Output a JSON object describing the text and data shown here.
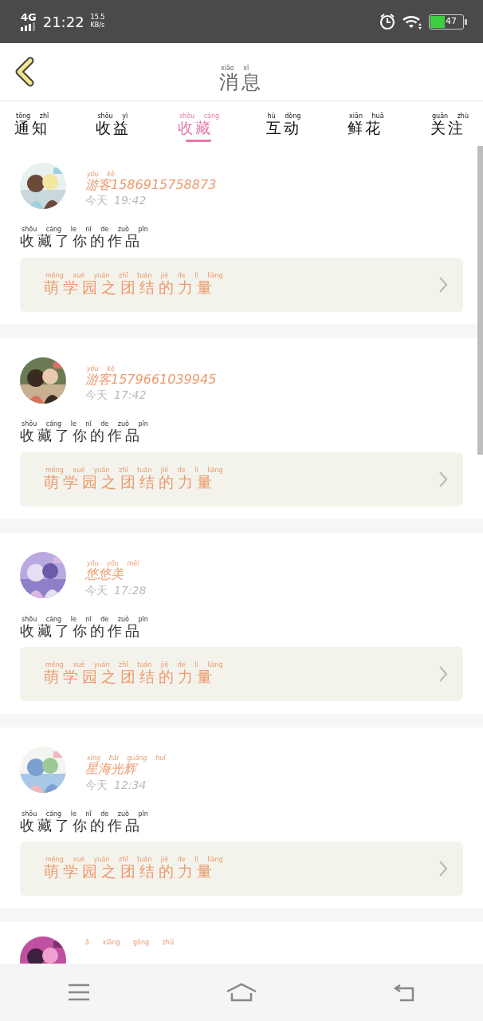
{
  "status_bar": {
    "network": "4G",
    "time": "21:22",
    "speed": "15.5",
    "speed_unit": "KB/s",
    "battery": "47"
  },
  "header": {
    "title": {
      "text": "消息",
      "pinyin": "xiāo xī"
    }
  },
  "tabs": [
    {
      "text": "通知",
      "pinyin": "tōng zhī",
      "selected": false
    },
    {
      "text": "收益",
      "pinyin": "shōu yì",
      "selected": false
    },
    {
      "text": "收藏",
      "pinyin": "shōu cáng",
      "selected": true
    },
    {
      "text": "互动",
      "pinyin": "hù dòng",
      "selected": false
    },
    {
      "text": "鲜花",
      "pinyin": "xiān huā",
      "selected": false
    },
    {
      "text": "关注",
      "pinyin": "guān zhù",
      "selected": false
    }
  ],
  "messages": [
    {
      "name": {
        "text": "游客1586915758873",
        "pinyin": "yóu kè"
      },
      "day": "今天",
      "time": "19:42",
      "action": {
        "text": "收藏了你的作品",
        "pinyin": "shōu cáng le nǐ de zuò pǐn"
      },
      "work": {
        "text": "萌学园之团结的力量",
        "pinyin": "méng xué yuán zhī tuán jié de lì liàng"
      }
    },
    {
      "name": {
        "text": "游客1579661039945",
        "pinyin": "yóu kè"
      },
      "day": "今天",
      "time": "17:42",
      "action": {
        "text": "收藏了你的作品",
        "pinyin": "shōu cáng le nǐ de zuò pǐn"
      },
      "work": {
        "text": "萌学园之团结的力量",
        "pinyin": "méng xué yuán zhī tuán jié de lì liàng"
      }
    },
    {
      "name": {
        "text": "悠悠美",
        "pinyin": "yōu yōu měi"
      },
      "day": "今天",
      "time": "17:28",
      "action": {
        "text": "收藏了你的作品",
        "pinyin": "shōu cáng le nǐ de zuò pǐn"
      },
      "work": {
        "text": "萌学园之团结的力量",
        "pinyin": "méng xué yuán zhī tuán jié de lì liàng"
      }
    },
    {
      "name": {
        "text": "星海光辉",
        "pinyin": "xīng hǎi guāng huī"
      },
      "day": "今天",
      "time": "12:34",
      "action": {
        "text": "收藏了你的作品",
        "pinyin": "shōu cáng le nǐ de zuò pǐn"
      },
      "work": {
        "text": "萌学园之团结的力量",
        "pinyin": "méng xué yuán zhī tuán jié de lì liàng"
      }
    }
  ],
  "partial_message": {
    "name_pinyin": "ā xiāng gōng zhǔ"
  }
}
